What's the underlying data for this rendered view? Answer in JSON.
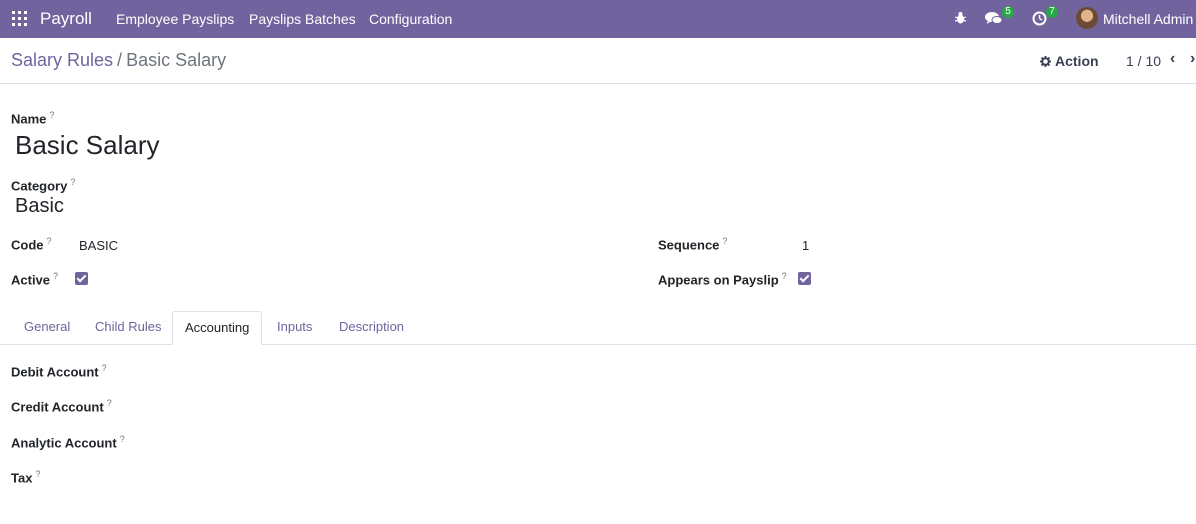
{
  "navbar": {
    "app_name": "Payroll",
    "menu": [
      "Employee Payslips",
      "Payslips Batches",
      "Configuration"
    ],
    "messages_count": "5",
    "activities_count": "7",
    "user_name": "Mitchell Admin",
    "background_color": "#71639e"
  },
  "breadcrumb": {
    "parent": "Salary Rules",
    "separator": "/",
    "current": "Basic Salary"
  },
  "toolbar": {
    "action_label": "Action",
    "pager": "1 / 10"
  },
  "form": {
    "name_label": "Name",
    "name_value": "Basic Salary",
    "category_label": "Category",
    "category_value": "Basic",
    "code_label": "Code",
    "code_value": "BASIC",
    "active_label": "Active",
    "active_checked": true,
    "sequence_label": "Sequence",
    "sequence_value": "1",
    "appears_label": "Appears on Payslip",
    "appears_checked": true,
    "help_marker": "?"
  },
  "tabs": [
    "General",
    "Child Rules",
    "Accounting",
    "Inputs",
    "Description"
  ],
  "active_tab": "Accounting",
  "accounting": {
    "debit_label": "Debit Account",
    "credit_label": "Credit Account",
    "analytic_label": "Analytic Account",
    "tax_label": "Tax"
  }
}
